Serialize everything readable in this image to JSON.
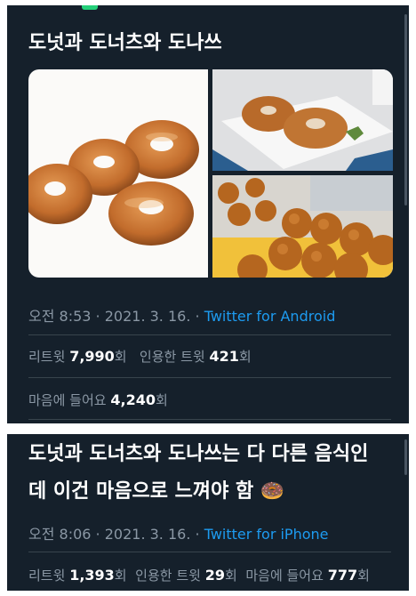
{
  "tweet1": {
    "text": "도넛과 도너츠와 도나쓰",
    "time": "오전 8:53",
    "date": "2021. 3. 16.",
    "source": "Twitter for Android",
    "retweets_label": "리트윗",
    "retweets": "7,990",
    "quotes_label": "인용한 트윗",
    "quotes": "421",
    "likes_label": "마음에 들어요",
    "likes": "4,240",
    "count_suffix": "회",
    "images": [
      "glazed-donuts-photo",
      "donuts-on-plate-photo",
      "mini-donut-balls-photo"
    ]
  },
  "tweet2": {
    "text_line1": "도넛과 도너츠와 도나쓰는 다 다른 음식인",
    "text_line2": "데 이건 마음으로 느껴야 함 🍩",
    "time": "오전 8:06",
    "date": "2021. 3. 16.",
    "source": "Twitter for iPhone",
    "retweets_label": "리트윗",
    "retweets": "1,393",
    "quotes_label": "인용한 트윗",
    "quotes": "29",
    "likes_label": "마음에 들어요",
    "likes": "777",
    "count_suffix": "회"
  },
  "separator": " · ",
  "colors": {
    "background": "#15202b",
    "link": "#1d9bf0",
    "muted": "#8b98a5",
    "divider": "#38444d"
  }
}
